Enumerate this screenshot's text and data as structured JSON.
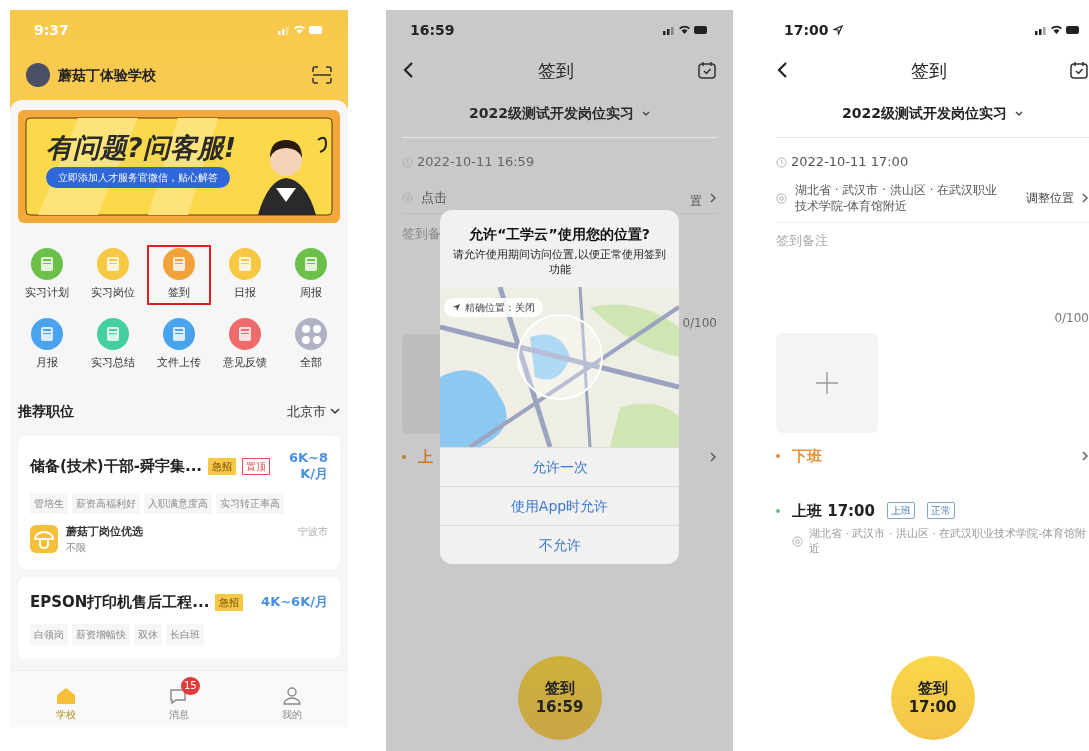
{
  "home_screen": {
    "status_time": "9:37",
    "school": "蘑菇丁体验学校",
    "banner": {
      "headline": "有问题?问客服!",
      "subline": "立即添加人才服务官微信，贴心解答"
    },
    "shortcuts": [
      {
        "label": "实习计划",
        "color": "#6cc04a",
        "highlighted": false
      },
      {
        "label": "实习岗位",
        "color": "#f7c843",
        "highlighted": false
      },
      {
        "label": "签到",
        "color": "#f2a23a",
        "highlighted": true
      },
      {
        "label": "日报",
        "color": "#f7c843",
        "highlighted": false
      },
      {
        "label": "周报",
        "color": "#6cc04a",
        "highlighted": false
      },
      {
        "label": "月报",
        "color": "#4aa3ef",
        "highlighted": false
      },
      {
        "label": "实习总结",
        "color": "#45cfa0",
        "highlighted": false
      },
      {
        "label": "文件上传",
        "color": "#4aa3ef",
        "highlighted": false
      },
      {
        "label": "意见反馈",
        "color": "#ef6a6a",
        "highlighted": false
      },
      {
        "label": "全部",
        "color": "#aeb2c4",
        "highlighted": false
      }
    ],
    "section_title": "推荐职位",
    "city": "北京市",
    "jobs": [
      {
        "title": "储备(技术)干部-舜宇集...",
        "badges": [
          {
            "label": "急招",
            "kind": "urgent"
          },
          {
            "label": "置顶",
            "kind": "pinned"
          }
        ],
        "salary": "6K~8K/月",
        "tags": [
          "管培生",
          "薪资高福利好",
          "入职满意度高",
          "实习转正率高"
        ],
        "company": "蘑菇丁岗位优选",
        "requirement": "不限",
        "location": "宁波市"
      },
      {
        "title": "EPSON打印机售后工程...",
        "badges": [
          {
            "label": "急招",
            "kind": "urgent"
          }
        ],
        "salary": "4K~6K/月",
        "tags": [
          "白领岗",
          "薪资增幅快",
          "双休",
          "长白班"
        ]
      }
    ],
    "tab_bar": [
      {
        "label": "学校",
        "selected": true
      },
      {
        "label": "消息",
        "selected": false,
        "badge": "15"
      },
      {
        "label": "我的",
        "selected": false
      }
    ]
  },
  "permission_screen": {
    "status_time": "16:59",
    "nav_title": "签到",
    "course": "2022级测试开发岗位实习",
    "datetime": "2022-10-11 16:59",
    "location_visible": "点击",
    "adjust_visible": "置",
    "remark_visible": "签到备",
    "counter": "0/100",
    "shift_visible": "上",
    "dialog": {
      "title": "允许“工学云”使用您的位置?",
      "message": "请允许使用期间访问位置,以便正常使用签到功能",
      "precise_location": "精确位置：关闭",
      "options": [
        "允许一次",
        "使用App时允许",
        "不允许"
      ]
    },
    "sign_button": {
      "label": "签到",
      "time": "16:59"
    }
  },
  "checkin_screen": {
    "status_time": "17:00",
    "nav_title": "签到",
    "course": "2022级测试开发岗位实习",
    "datetime": "2022-10-11 17:00",
    "location": "湖北省 · 武汉市 · 洪山区 · 在武汉职业技术学院-体育馆附近",
    "adjust": "调整位置",
    "remark_placeholder": "签到备注",
    "counter": "0/100",
    "records": [
      {
        "label": "下班",
        "color": "#e8913a"
      },
      {
        "label": "上班 17:00",
        "color": "#5cc28a",
        "tags": [
          "上班",
          "正常"
        ],
        "address": "湖北省 · 武汉市 · 洪山区 · 在武汉职业技术学院-体育馆附近"
      }
    ],
    "sign_button": {
      "label": "签到",
      "time": "17:00"
    }
  }
}
